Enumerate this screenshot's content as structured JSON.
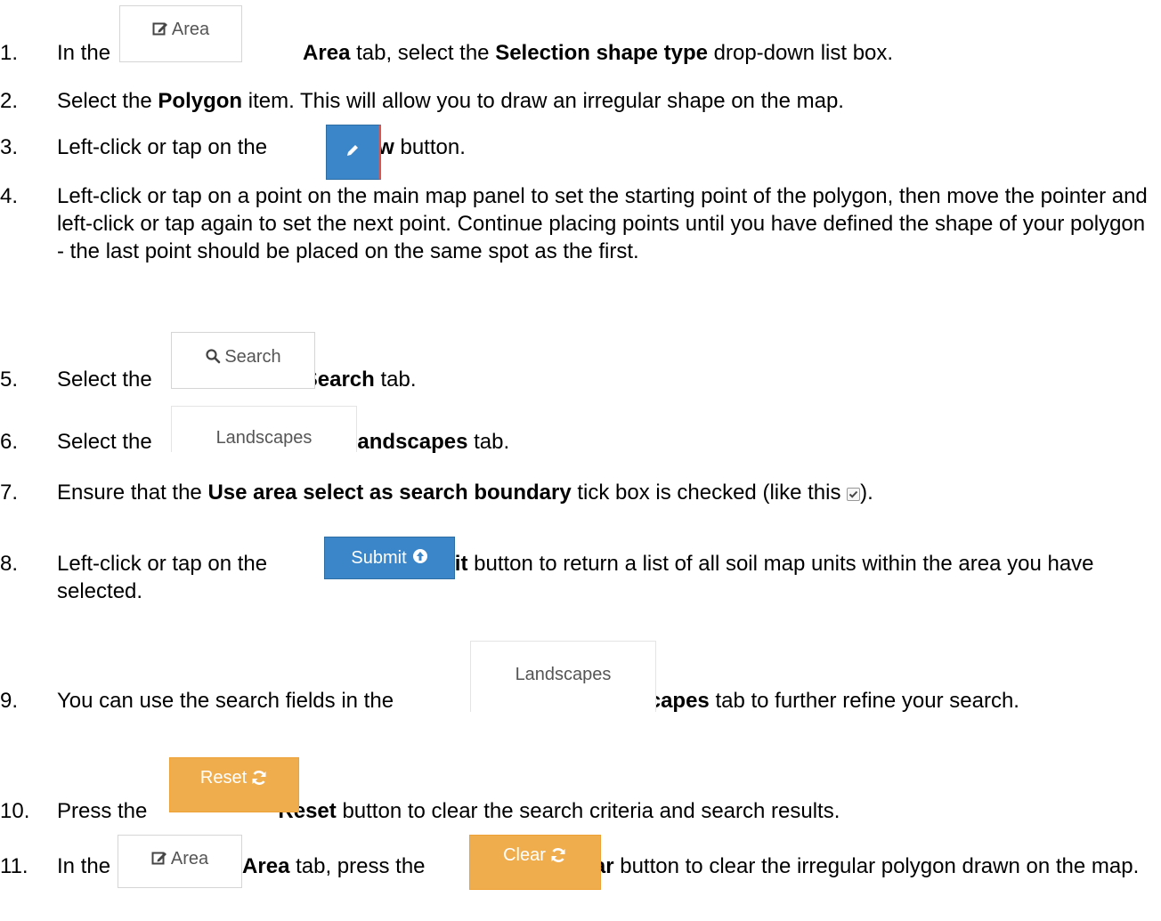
{
  "steps": [
    {
      "num": "1.",
      "parts": [
        "In the",
        "Area",
        "tab, select the",
        "Selection shape type",
        "drop-down list box."
      ]
    },
    {
      "num": "2.",
      "parts": [
        "Select the",
        "Polygon",
        "item. This will allow you to draw an irregular shape on the map."
      ]
    },
    {
      "num": "3.",
      "parts": [
        "Left-click or tap on the",
        "Draw",
        "button."
      ]
    },
    {
      "num": "4.",
      "text": "Left-click or tap on a point on the main map panel to set the starting point of the polygon, then move the pointer and left-click or tap again to set the next point. Continue placing points until you have defined the shape of your polygon - the last point should be placed on the same spot as the first."
    },
    {
      "num": "5.",
      "parts": [
        "Select the",
        "Search",
        "tab."
      ]
    },
    {
      "num": "6.",
      "parts": [
        "Select the",
        "Landscapes",
        "tab."
      ]
    },
    {
      "num": "7.",
      "parts": [
        "Ensure that the",
        "Use area select as search boundary",
        "tick box is checked (like this",
        ")."
      ]
    },
    {
      "num": "8.",
      "parts": [
        "Left-click or tap on the",
        "Submit",
        "button to return a list of all soil map units within the area you have selected."
      ]
    },
    {
      "num": "9.",
      "parts": [
        "You can use the search fields in the",
        "Landscapes",
        "tab to further refine your search."
      ]
    },
    {
      "num": "10.",
      "parts": [
        "Press the",
        "Reset",
        "button to clear the search criteria and search results."
      ]
    },
    {
      "num": "11.",
      "parts": [
        "In the",
        "Area",
        "tab, press the",
        "Clear",
        "button to clear the irregular polygon drawn on the map."
      ]
    }
  ],
  "buttons": {
    "area": "Area",
    "search": "Search",
    "landscapes": "Landscapes",
    "submit": "Submit",
    "reset": "Reset",
    "clear": "Clear"
  },
  "colors": {
    "primary": "#3a86c8",
    "warning": "#f0ad4e"
  },
  "icons": [
    "edit-icon",
    "pencil-icon",
    "search-icon",
    "checkbox-icon",
    "arrow-up-circle-icon",
    "refresh-icon"
  ]
}
